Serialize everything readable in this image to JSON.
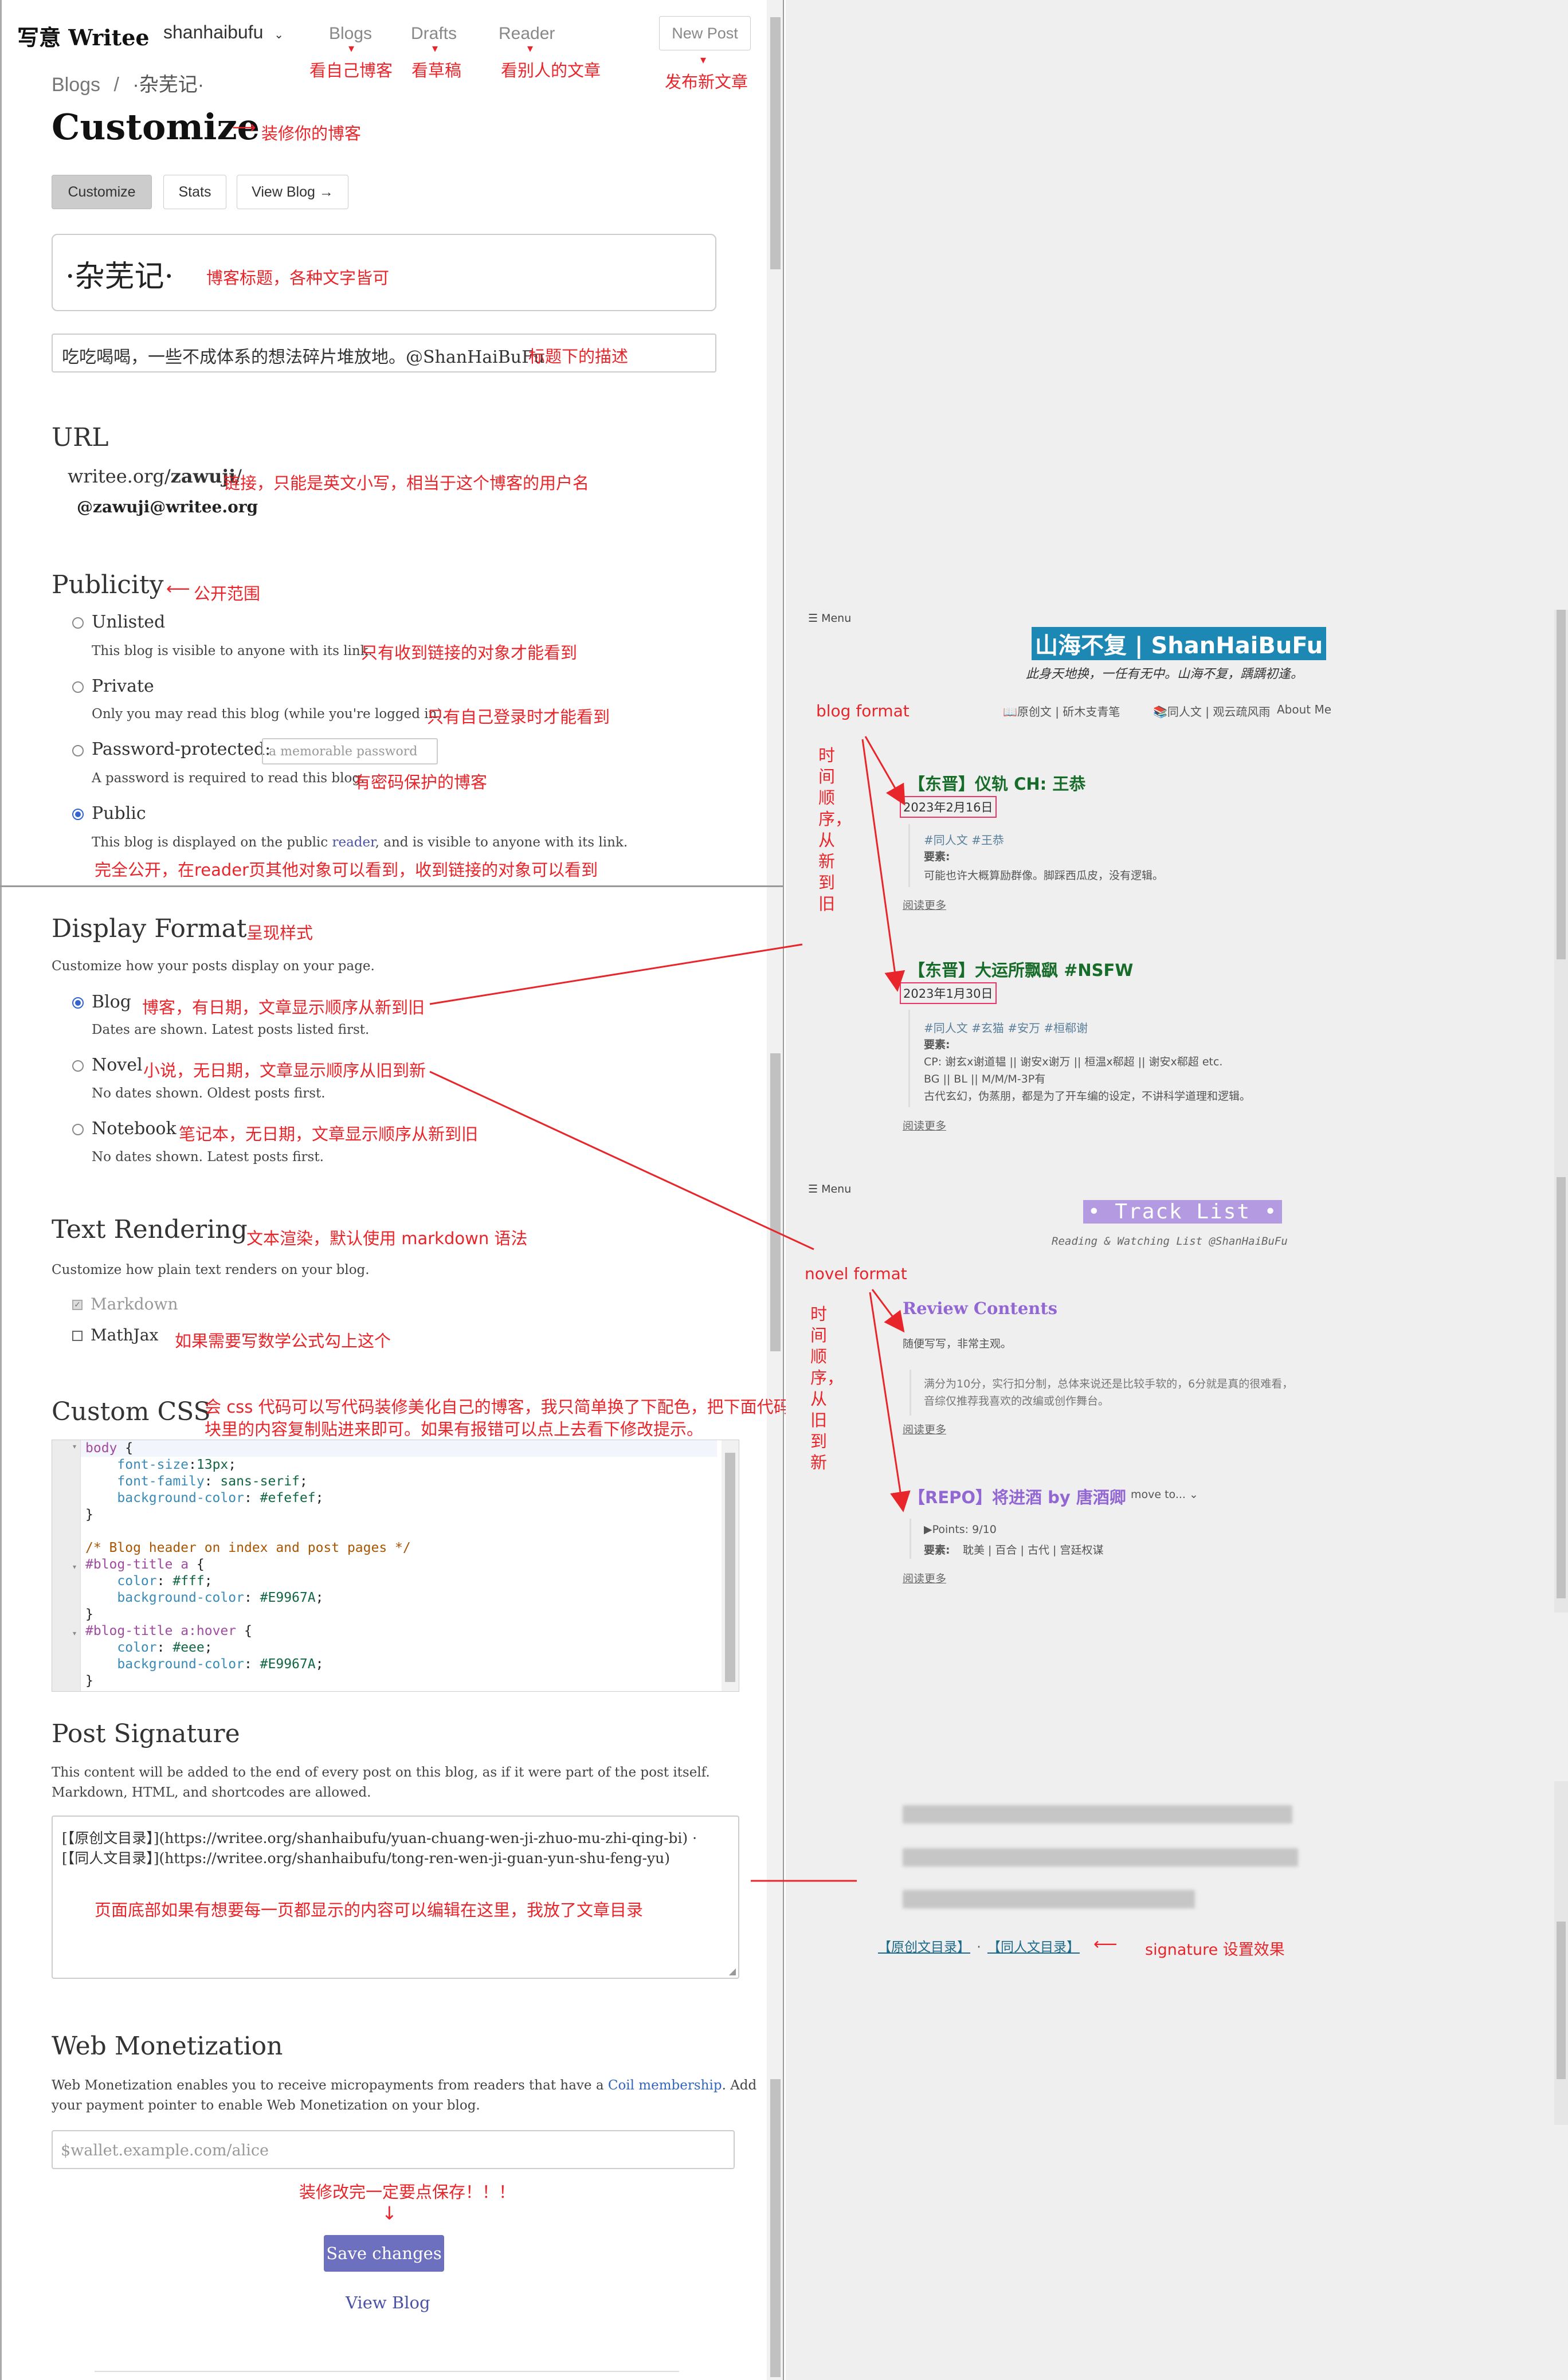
{
  "nav": {
    "logo": "写意 Writee",
    "user": "shanhaibufu",
    "blogs": "Blogs",
    "drafts": "Drafts",
    "reader": "Reader",
    "new_post": "New Post"
  },
  "breadcrumb": {
    "blogs": "Blogs",
    "sep": "/",
    "current": "·杂芜记·"
  },
  "page_title": "Customize",
  "tabs": {
    "customize": "Customize",
    "stats": "Stats",
    "view_blog": "View Blog →"
  },
  "blog_title_value": "·杂芜记·",
  "blog_desc_value": "吃吃喝喝，一些不成体系的想法碎片堆放地。@ShanHaiBuFu",
  "url": {
    "heading": "URL",
    "prefix": "writee.org/",
    "alias": "zawuji",
    "suffix": "/",
    "handle": "@zawuji@writee.org"
  },
  "publicity": {
    "heading": "Publicity",
    "options": [
      {
        "label": "Unlisted",
        "desc": "This blog is visible to anyone with its link."
      },
      {
        "label": "Private",
        "desc": "Only you may read this blog (while you're logged in)."
      },
      {
        "label": "Password-protected:",
        "desc": "A password is required to read this blog.",
        "placeholder": "a memorable password"
      },
      {
        "label": "Public",
        "desc_pre": "This blog is displayed on the public ",
        "desc_link": "reader",
        "desc_post": ", and is visible to anyone with its link."
      }
    ]
  },
  "display_format": {
    "heading": "Display Format",
    "desc": "Customize how your posts display on your page.",
    "options": [
      {
        "label": "Blog",
        "desc": "Dates are shown. Latest posts listed first."
      },
      {
        "label": "Novel",
        "desc": "No dates shown. Oldest posts first."
      },
      {
        "label": "Notebook",
        "desc": "No dates shown. Latest posts first."
      }
    ]
  },
  "text_rendering": {
    "heading": "Text Rendering",
    "desc": "Customize how plain text renders on your blog.",
    "markdown": "Markdown",
    "mathjax": "MathJax"
  },
  "custom_css": {
    "heading": "Custom CSS"
  },
  "post_signature": {
    "heading": "Post Signature",
    "desc1": "This content will be added to the end of every post on this blog, as if it were part of the post itself.",
    "desc2": "Markdown, HTML, and shortcodes are allowed.",
    "line1": "[【原创文目录】](https://writee.org/shanhaibufu/yuan-chuang-wen-ji-zhuo-mu-zhi-qing-bi) ·",
    "line2": "[【同人文目录】](https://writee.org/shanhaibufu/tong-ren-wen-ji-guan-yun-shu-feng-yu)"
  },
  "web_monetization": {
    "heading": "Web Monetization",
    "desc1_pre": "Web Monetization enables you to receive micropayments from readers that have a ",
    "desc1_link": "Coil membership",
    "desc1_post": ". Add",
    "desc2": "your payment pointer to enable Web Monetization on your blog.",
    "placeholder": "$wallet.example.com/alice"
  },
  "save_button": "Save changes",
  "view_blog_link": "View Blog",
  "annotations": {
    "blogs": "看自己博客",
    "drafts": "看草稿",
    "reader": "看别人的文章",
    "new_post": "发布新文章",
    "customize": "装修你的博客",
    "title": "博客标题，各种文字皆可",
    "desc": "标题下的描述",
    "url": "链接，只能是英文小写，相当于这个博客的用户名",
    "publicity": "公开范围",
    "unlisted": "只有收到链接的对象才能看到",
    "private": "只有自己登录时才能看到",
    "password": "有密码保护的博客",
    "public": "完全公开，在reader页其他对象可以看到，收到链接的对象可以看到",
    "display": "呈现样式",
    "blog": "博客，有日期，文章显示顺序从新到旧",
    "novel": "小说，无日期，文章显示顺序从旧到新",
    "notebook": "笔记本，无日期，文章显示顺序从新到旧",
    "text_render": "文本渲染，默认使用 markdown 语法",
    "mathjax": "如果需要写数学公式勾上这个",
    "css1": "会 css 代码可以写代码装修美化自己的博客，我只简单换了下配色，把下面代码",
    "css2": "块里的内容复制贴进来即可。如果有报错可以点上去看下修改提示。",
    "signature": "页面底部如果有想要每一页都显示的内容可以编辑在这里，我放了文章目录",
    "save": "装修改完一定要点保存！！！",
    "blog_format": "blog format",
    "novel_format": "novel format",
    "time_new_old": "时间顺序，从新到旧",
    "time_old_new": "时间顺序，从旧到新",
    "signature_effect": "signature 设置效果"
  },
  "blog_preview": {
    "menu": "☰ Menu",
    "title": "山海不复 | ShanHaiBuFu",
    "tagline": "此身天地换，一任有无中。山海不复，踽踽初逢。",
    "nav1": "📖原创文 | 斫木支青笔",
    "nav2": "📚同人文 | 观云疏风雨",
    "nav3": "About Me",
    "posts": [
      {
        "title": "【东晋】仪轨 CH: 王恭",
        "date": "2023年2月16日",
        "tags": "#同人文 #王恭",
        "label": "要素:",
        "lines": [
          "可能也许大概算励群像。脚踩西瓜皮，没有逻辑。"
        ],
        "more": "阅读更多"
      },
      {
        "title": "【东晋】大运所飘飖 #NSFW",
        "date": "2023年1月30日",
        "tags": "#同人文 #玄猫 #安万 #桓郗谢",
        "label": "要素:",
        "lines": [
          "CP: 谢玄x谢道韫 || 谢安x谢万 || 桓温x郗超 || 谢安x郗超 etc.",
          "BG || BL || M/M/M-3P有",
          "古代玄幻，伪蒸朋，都是为了开车编的设定，不讲科学道理和逻辑。"
        ],
        "more": "阅读更多"
      }
    ]
  },
  "novel_preview": {
    "menu": "☰ Menu",
    "title": "• Track List •",
    "tagline": "Reading & Watching List @ShanHaiBuFu",
    "posts": [
      {
        "title": "Review Contents",
        "sub": "随便写写，非常主观。",
        "lines": [
          "满分为10分，实行扣分制，总体来说还是比较手软的，6分就是真的很难看，",
          "音综仅推荐我喜欢的改编或创作舞台。"
        ],
        "more": "阅读更多"
      },
      {
        "title": "【REPO】将进酒 by 唐酒卿",
        "move": "move to...",
        "points": "▶Points: 9/10",
        "label": "要素:",
        "line": "耽美 | 百合 | 古代 | 宫廷权谋",
        "more": "阅读更多"
      }
    ]
  },
  "signature_preview": {
    "link1": "【原创文目录】",
    "sep": "·",
    "link2": "【同人文目录】"
  }
}
